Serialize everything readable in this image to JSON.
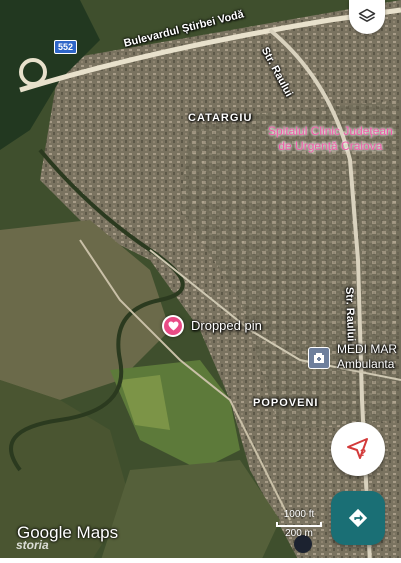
{
  "map": {
    "route_number": "552",
    "roads": [
      "Bulevardul Știrbei Vodă",
      "Str. Raului",
      "Str. Raului"
    ],
    "areas": [
      "CATARGIU",
      "POPOVENI"
    ],
    "hospital": [
      "Spitalul Clinic Județean",
      "de Urgență Craiova"
    ],
    "poi": [
      "MEDI MAR",
      "Ambulanta"
    ],
    "dropped_pin": "Dropped pin",
    "scale": [
      "1000 ft",
      "200 m"
    ],
    "logo": "Google Maps",
    "watermark": "storia"
  },
  "icons": {
    "layers": "layers-icon",
    "pin": "heart-pin-icon",
    "poi": "medical-building-icon",
    "location": "location-unknown-icon",
    "directions": "directions-icon"
  },
  "colors": {
    "pin": "#e94b86",
    "hospital_text": "#f05ba8",
    "directions_button": "#1a6f75",
    "route_shield": "#2f66c9"
  }
}
